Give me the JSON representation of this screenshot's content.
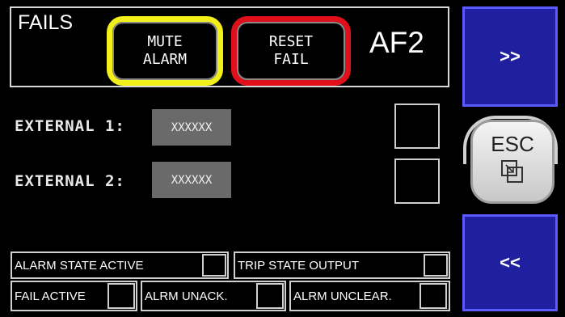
{
  "header": {
    "title": "FAILS",
    "mute_label": "MUTE\nALARM",
    "reset_label": "RESET\nFAIL",
    "station_code": "AF2"
  },
  "externals": [
    {
      "label": "EXTERNAL  1:",
      "value": "XXXXXX"
    },
    {
      "label": "EXTERNAL  2:",
      "value": "XXXXXX"
    }
  ],
  "status": {
    "alarm_state_active": "ALARM STATE ACTIVE",
    "trip_state_output": "TRIP STATE OUTPUT",
    "fail_active": "FAIL ACTIVE",
    "alrm_unack": "ALRM UNACK.",
    "alrm_unclear": "ALRM UNCLEAR."
  },
  "nav": {
    "next_label": ">>",
    "esc_label": "ESC",
    "prev_label": "<<"
  },
  "colors": {
    "mute_border": "#f2ef1a",
    "reset_border": "#e0101a",
    "nav_blue": "#1f1fa0",
    "value_box": "#6a6a6a"
  },
  "icons": [
    "copy-windows-icon"
  ]
}
